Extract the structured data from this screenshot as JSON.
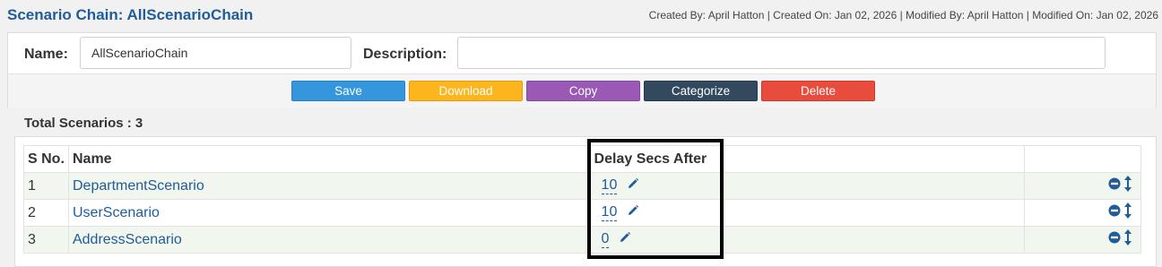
{
  "header": {
    "title": "Scenario Chain: AllScenarioChain",
    "meta": "Created By: April Hatton | Created On: Jan 02, 2026 | Modified By: April Hatton | Modified On: Jan 02, 2026"
  },
  "form": {
    "name_label": "Name:",
    "name_value": "AllScenarioChain",
    "description_label": "Description:",
    "description_value": ""
  },
  "buttons": {
    "save": "Save",
    "download": "Download",
    "copy": "Copy",
    "categorize": "Categorize",
    "delete": "Delete"
  },
  "total_label": "Total Scenarios : 3",
  "table": {
    "headers": {
      "sno": "S No.",
      "name": "Name",
      "delay": "Delay Secs After",
      "actions": ""
    },
    "rows": [
      {
        "sno": "1",
        "name": "DepartmentScenario",
        "delay": "10"
      },
      {
        "sno": "2",
        "name": "UserScenario",
        "delay": "10"
      },
      {
        "sno": "3",
        "name": "AddressScenario",
        "delay": "0"
      }
    ]
  },
  "icons": {
    "edit": "pencil-icon",
    "remove": "minus-circle-icon",
    "reorder": "vertical-arrows-icon"
  },
  "colors": {
    "title": "#1f5c99",
    "save": "#3596dd",
    "download": "#fdb51d",
    "copy": "#9a59b4",
    "categorize": "#33495e",
    "delete": "#e84c3d",
    "row_alt": "#f1f6ef"
  }
}
